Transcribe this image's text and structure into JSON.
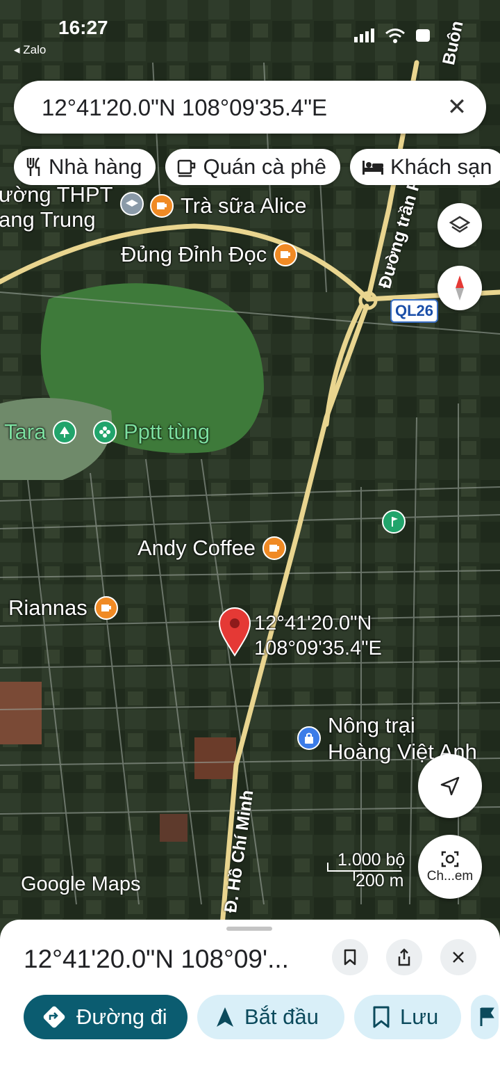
{
  "status_bar": {
    "time": "16:27",
    "back_app": "◂ Zalo"
  },
  "search": {
    "query": "12°41'20.0\"N 108°09'35.4\"E",
    "close_glyph": "✕"
  },
  "chips": [
    {
      "label": "Nhà hàng",
      "icon": "restaurant-icon"
    },
    {
      "label": "Quán cà phê",
      "icon": "coffee-icon"
    },
    {
      "label": "Khách sạn",
      "icon": "hotel-icon"
    }
  ],
  "map": {
    "pois": [
      {
        "label": "ường THPT\nang Trung",
        "icon": "school-icon"
      },
      {
        "label": "Trà sữa Alice",
        "icon": "cafe-icon"
      },
      {
        "label": "Đủng Đỉnh Đọc",
        "icon": "cafe-icon"
      },
      {
        "label": "Tara",
        "icon": "tree-icon"
      },
      {
        "label": "Pptt tùng",
        "icon": "flower-icon"
      },
      {
        "label": "Andy Coffee",
        "icon": "cafe-icon"
      },
      {
        "label": "Riannas",
        "icon": "cafe-icon"
      },
      {
        "label": "Nông trại\nHoàng Việt Anh",
        "icon": "lock-bag-icon"
      }
    ],
    "roads": {
      "top_right": "Buôn",
      "vertical_upper": "Đường trần Phú",
      "vertical_lower": "Đ. Hồ Chí Minh",
      "highway_shield": "QL26"
    },
    "pin_label": {
      "line1": "12°41'20.0\"N",
      "line2": "108°09'35.4\"E"
    },
    "scale": {
      "top": "1.000 bộ",
      "bottom": "200 m"
    },
    "attribution": "Google Maps",
    "camera_button_label": "Ch...em"
  },
  "sheet": {
    "title": "12°41'20.0\"N 108°09'...",
    "actions": [
      {
        "label": "Đường đi",
        "icon": "directions-icon"
      },
      {
        "label": "Bắt đầu",
        "icon": "navigate-icon"
      },
      {
        "label": "Lưu",
        "icon": "bookmark-icon"
      }
    ]
  },
  "colors": {
    "accent": "#0b5c70",
    "pin": "#e53935",
    "road": "#e9d58f"
  }
}
